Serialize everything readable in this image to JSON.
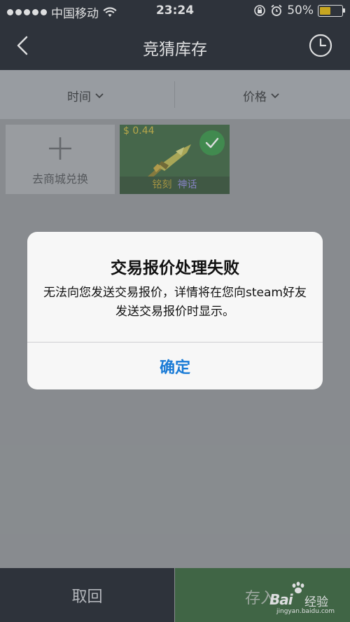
{
  "status_bar": {
    "carrier": "中国移动",
    "time": "23:24",
    "battery": "50%",
    "battery_level": 0.5,
    "icons": [
      "signal-dots-icon",
      "wifi-icon",
      "rotation-lock-icon",
      "alarm-icon",
      "battery-icon"
    ]
  },
  "nav": {
    "title": "竞猜库存",
    "back_icon": "chevron-left-icon",
    "history_icon": "clock-icon"
  },
  "filters": [
    {
      "label": "时间",
      "icon": "chevron-down-icon"
    },
    {
      "label": "价格",
      "icon": "chevron-down-icon"
    }
  ],
  "cards": {
    "add_label": "去商城兑换",
    "item": {
      "price": "$ 0.44",
      "tag1": "铭刻",
      "tag2": "神话",
      "selected": true
    }
  },
  "bottom": {
    "cancel_label": "取回",
    "store_label": "存入"
  },
  "alert": {
    "title": "交易报价处理失败",
    "message": "无法向您发送交易报价，详情将在您向steam好友发送交易报价时显示。",
    "ok_label": "确定"
  },
  "watermark": {
    "brand": "Bai",
    "brand_suffix": "经验",
    "url": "jingyan.baidu.com"
  },
  "colors": {
    "nav_bg": "#161b24",
    "accent_blue": "#1a7bd6",
    "store_green": "#2e5e32",
    "check_green": "#2f8f3f"
  }
}
